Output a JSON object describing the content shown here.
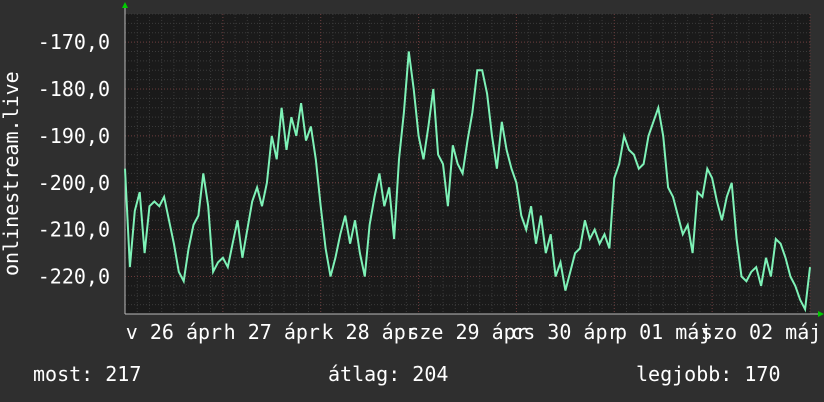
{
  "chart_data": {
    "type": "line",
    "ylabel": "onlinestream.live",
    "ylim": [
      -228,
      -164
    ],
    "grid": true,
    "colors": {
      "line": "#7ef2b7",
      "background": "#2f2f2f",
      "plot_bg": "#1a1a1a",
      "axis_arrow": "#00cc00"
    },
    "y_ticks": [
      {
        "value": -170,
        "label": "-170,0"
      },
      {
        "value": -180,
        "label": "-180,0"
      },
      {
        "value": -190,
        "label": "-190,0"
      },
      {
        "value": -200,
        "label": "-200,0"
      },
      {
        "value": -210,
        "label": "-210,0"
      },
      {
        "value": -220,
        "label": "-220,0"
      }
    ],
    "x_ticks": [
      {
        "pos": 0.5,
        "label": "v 26 ápr"
      },
      {
        "pos": 1.5,
        "label": "h 27 ápr"
      },
      {
        "pos": 2.5,
        "label": "k 28 ápr"
      },
      {
        "pos": 3.5,
        "label": "sze 29 ápr"
      },
      {
        "pos": 4.5,
        "label": "cs 30 ápr"
      },
      {
        "pos": 5.5,
        "label": "p 01 máj"
      },
      {
        "pos": 6.5,
        "label": "szo 02 máj"
      }
    ],
    "x_range": [
      0,
      7
    ],
    "series": [
      {
        "x": [
          0,
          0.05,
          0.1,
          0.15,
          0.2,
          0.25,
          0.3,
          0.35,
          0.4,
          0.45,
          0.5,
          0.55,
          0.6,
          0.65,
          0.7,
          0.75,
          0.8,
          0.85,
          0.9,
          0.95,
          1.0,
          1.05,
          1.1,
          1.15,
          1.2,
          1.25,
          1.3,
          1.35,
          1.4,
          1.45,
          1.5,
          1.55,
          1.6,
          1.65,
          1.7,
          1.75,
          1.8,
          1.85,
          1.9,
          1.95,
          2.0,
          2.05,
          2.1,
          2.15,
          2.2,
          2.25,
          2.3,
          2.35,
          2.4,
          2.45,
          2.5,
          2.55,
          2.6,
          2.65,
          2.7,
          2.75,
          2.8,
          2.85,
          2.9,
          2.95,
          3.0,
          3.05,
          3.1,
          3.15,
          3.2,
          3.25,
          3.3,
          3.35,
          3.4,
          3.45,
          3.5,
          3.55,
          3.6,
          3.65,
          3.7,
          3.75,
          3.8,
          3.85,
          3.9,
          3.95,
          4.0,
          4.05,
          4.1,
          4.15,
          4.2,
          4.25,
          4.3,
          4.35,
          4.4,
          4.45,
          4.5,
          4.55,
          4.6,
          4.65,
          4.7,
          4.75,
          4.8,
          4.85,
          4.9,
          4.95,
          5.0,
          5.05,
          5.1,
          5.15,
          5.2,
          5.25,
          5.3,
          5.35,
          5.4,
          5.45,
          5.5,
          5.55,
          5.6,
          5.65,
          5.7,
          5.75,
          5.8,
          5.85,
          5.9,
          5.95,
          6.0,
          6.05,
          6.1,
          6.15,
          6.2,
          6.25,
          6.3,
          6.35,
          6.4,
          6.45,
          6.5,
          6.55,
          6.6,
          6.65,
          6.7,
          6.75,
          6.8,
          6.85,
          6.9,
          6.95,
          7.0
        ],
        "values": [
          -197,
          -218,
          -206,
          -202,
          -215,
          -205,
          -204,
          -205,
          -203,
          -208,
          -213,
          -219,
          -221,
          -214,
          -209,
          -207,
          -198,
          -205,
          -219,
          -217,
          -216,
          -218,
          -213,
          -208,
          -216,
          -210,
          -204,
          -201,
          -205,
          -200,
          -190,
          -195,
          -184,
          -193,
          -186,
          -190,
          -183,
          -191,
          -188,
          -195,
          -205,
          -214,
          -220,
          -216,
          -211,
          -207,
          -213,
          -208,
          -215,
          -220,
          -209,
          -203,
          -198,
          -205,
          -201,
          -212,
          -195,
          -185,
          -172,
          -180,
          -190,
          -195,
          -188,
          -180,
          -194,
          -196,
          -205,
          -192,
          -196,
          -198,
          -191,
          -185,
          -176,
          -176,
          -181,
          -190,
          -197,
          -187,
          -193,
          -197,
          -200,
          -207,
          -210,
          -205,
          -213,
          -207,
          -215,
          -211,
          -220,
          -217,
          -223,
          -219,
          -215,
          -214,
          -208,
          -212,
          -210,
          -213,
          -211,
          -214,
          -199,
          -196,
          -190,
          -193,
          -194,
          -197,
          -196,
          -190,
          -187,
          -184,
          -190,
          -201,
          -203,
          -207,
          -211,
          -209,
          -215,
          -202,
          -203,
          -197,
          -199,
          -204,
          -208,
          -203,
          -200,
          -212,
          -220,
          -221,
          -219,
          -218,
          -222,
          -216,
          -220,
          -212,
          -213,
          -216,
          -220,
          -222,
          -225,
          -227,
          -218
        ],
        "name": ""
      }
    ]
  },
  "stats": {
    "current": "most: 217",
    "average": "átlag: 204",
    "best": "legjobb: 170"
  }
}
